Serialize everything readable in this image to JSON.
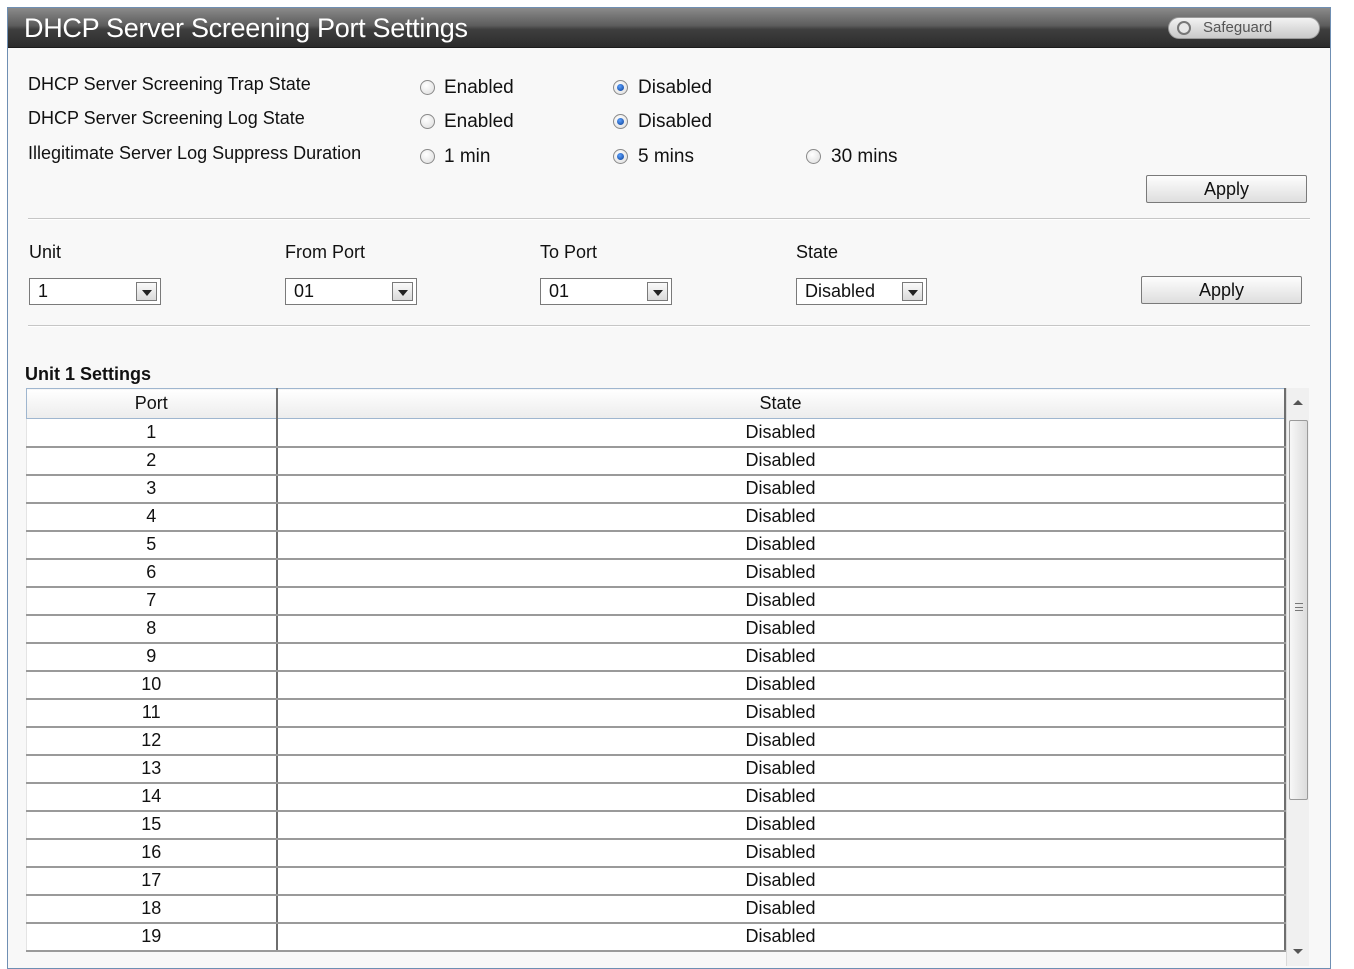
{
  "header": {
    "title": "DHCP Server Screening Port Settings",
    "safeguard_label": "Safeguard"
  },
  "global_settings": {
    "trap_state": {
      "label": "DHCP Server Screening Trap State",
      "options": [
        "Enabled",
        "Disabled"
      ],
      "selected": "Disabled"
    },
    "log_state": {
      "label": "DHCP Server Screening Log State",
      "options": [
        "Enabled",
        "Disabled"
      ],
      "selected": "Disabled"
    },
    "suppress_duration": {
      "label": "Illegitimate Server Log Suppress Duration",
      "options": [
        "1 min",
        "5 mins",
        "30 mins"
      ],
      "selected": "5 mins"
    },
    "apply_label": "Apply"
  },
  "port_form": {
    "unit_label": "Unit",
    "unit_value": "1",
    "from_port_label": "From Port",
    "from_port_value": "01",
    "to_port_label": "To Port",
    "to_port_value": "01",
    "state_label": "State",
    "state_value": "Disabled",
    "apply_label": "Apply"
  },
  "table": {
    "caption": "Unit 1 Settings",
    "columns": [
      "Port",
      "State"
    ],
    "rows": [
      {
        "port": "1",
        "state": "Disabled"
      },
      {
        "port": "2",
        "state": "Disabled"
      },
      {
        "port": "3",
        "state": "Disabled"
      },
      {
        "port": "4",
        "state": "Disabled"
      },
      {
        "port": "5",
        "state": "Disabled"
      },
      {
        "port": "6",
        "state": "Disabled"
      },
      {
        "port": "7",
        "state": "Disabled"
      },
      {
        "port": "8",
        "state": "Disabled"
      },
      {
        "port": "9",
        "state": "Disabled"
      },
      {
        "port": "10",
        "state": "Disabled"
      },
      {
        "port": "11",
        "state": "Disabled"
      },
      {
        "port": "12",
        "state": "Disabled"
      },
      {
        "port": "13",
        "state": "Disabled"
      },
      {
        "port": "14",
        "state": "Disabled"
      },
      {
        "port": "15",
        "state": "Disabled"
      },
      {
        "port": "16",
        "state": "Disabled"
      },
      {
        "port": "17",
        "state": "Disabled"
      },
      {
        "port": "18",
        "state": "Disabled"
      },
      {
        "port": "19",
        "state": "Disabled"
      }
    ]
  }
}
